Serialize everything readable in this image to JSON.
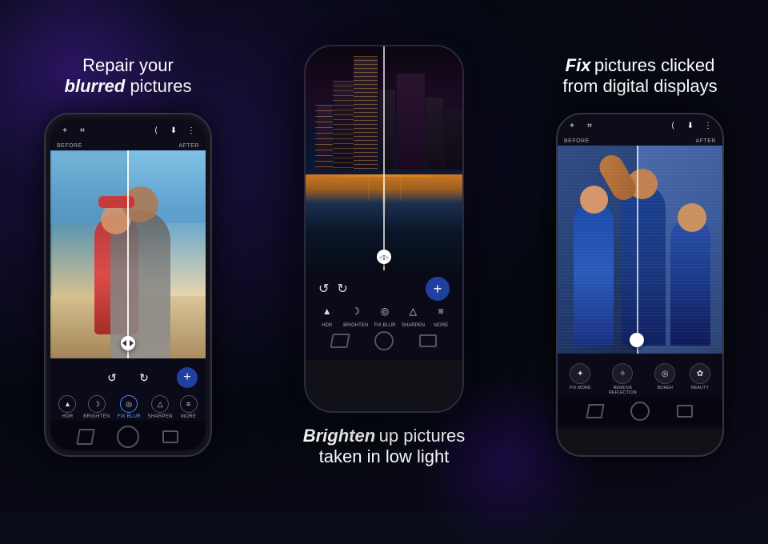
{
  "left": {
    "heading_line1": "Repair your",
    "heading_bold": "blurred",
    "heading_line2": "pictures",
    "toolbar": {
      "icons": [
        "+",
        "⌗",
        "⟨",
        "⬇",
        "⋮"
      ]
    },
    "before_label": "BEFORE",
    "after_label": "AFTER",
    "bottom_tools": [
      {
        "label": "HDR",
        "icon": "▲"
      },
      {
        "label": "BRIGHTEN",
        "icon": "☽"
      },
      {
        "label": "FIX BLUR",
        "icon": "◎"
      },
      {
        "label": "SHARPEN",
        "icon": "▲"
      },
      {
        "label": "MORE",
        "icon": "≡"
      }
    ]
  },
  "center": {
    "heading_bold": "Brighten",
    "heading_rest": "up pictures",
    "heading_line2": "taken in low light",
    "bottom_tools": [
      {
        "label": "HDR",
        "icon": "▲"
      },
      {
        "label": "BRIGHTEN",
        "icon": "☽"
      },
      {
        "label": "FIX BLUR",
        "icon": "◎"
      },
      {
        "label": "SHARPEN",
        "icon": "△"
      },
      {
        "label": "MORE",
        "icon": "≡"
      }
    ]
  },
  "right": {
    "heading_fix": "Fix",
    "heading_rest": "pictures clicked",
    "heading_line2": "from digital displays",
    "before_label": "BEFORE",
    "after_label": "AFTER",
    "bottom_tools": [
      {
        "label": "FIX MORE",
        "icon": "✦"
      },
      {
        "label": "REMOVE REFLECTION",
        "icon": "✧"
      },
      {
        "label": "BOKEH",
        "icon": "◎"
      },
      {
        "label": "BEAUTY",
        "icon": "✿"
      }
    ]
  }
}
